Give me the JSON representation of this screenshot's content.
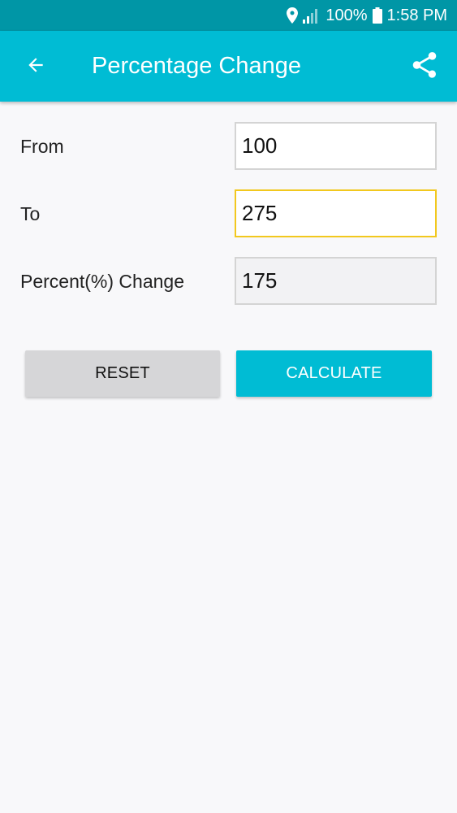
{
  "status_bar": {
    "battery_text": "100%",
    "time": "1:58 PM",
    "icons": [
      "location-icon",
      "signal-icon",
      "battery-icon"
    ]
  },
  "app_bar": {
    "title": "Percentage Change",
    "back_icon": "arrow-back-icon",
    "share_icon": "share-icon"
  },
  "form": {
    "from_label": "From",
    "from_value": "100",
    "to_label": "To",
    "to_value": "275",
    "percent_label": "Percent(%) Change",
    "percent_value": "175"
  },
  "buttons": {
    "reset_label": "RESET",
    "calculate_label": "CALCULATE"
  },
  "colors": {
    "status_bar": "#0096a6",
    "app_bar": "#00bcd4",
    "accent": "#00bcd4",
    "focus_border": "#f2c81e",
    "background": "#f8f8fa",
    "reset_button": "#d6d6d8"
  }
}
